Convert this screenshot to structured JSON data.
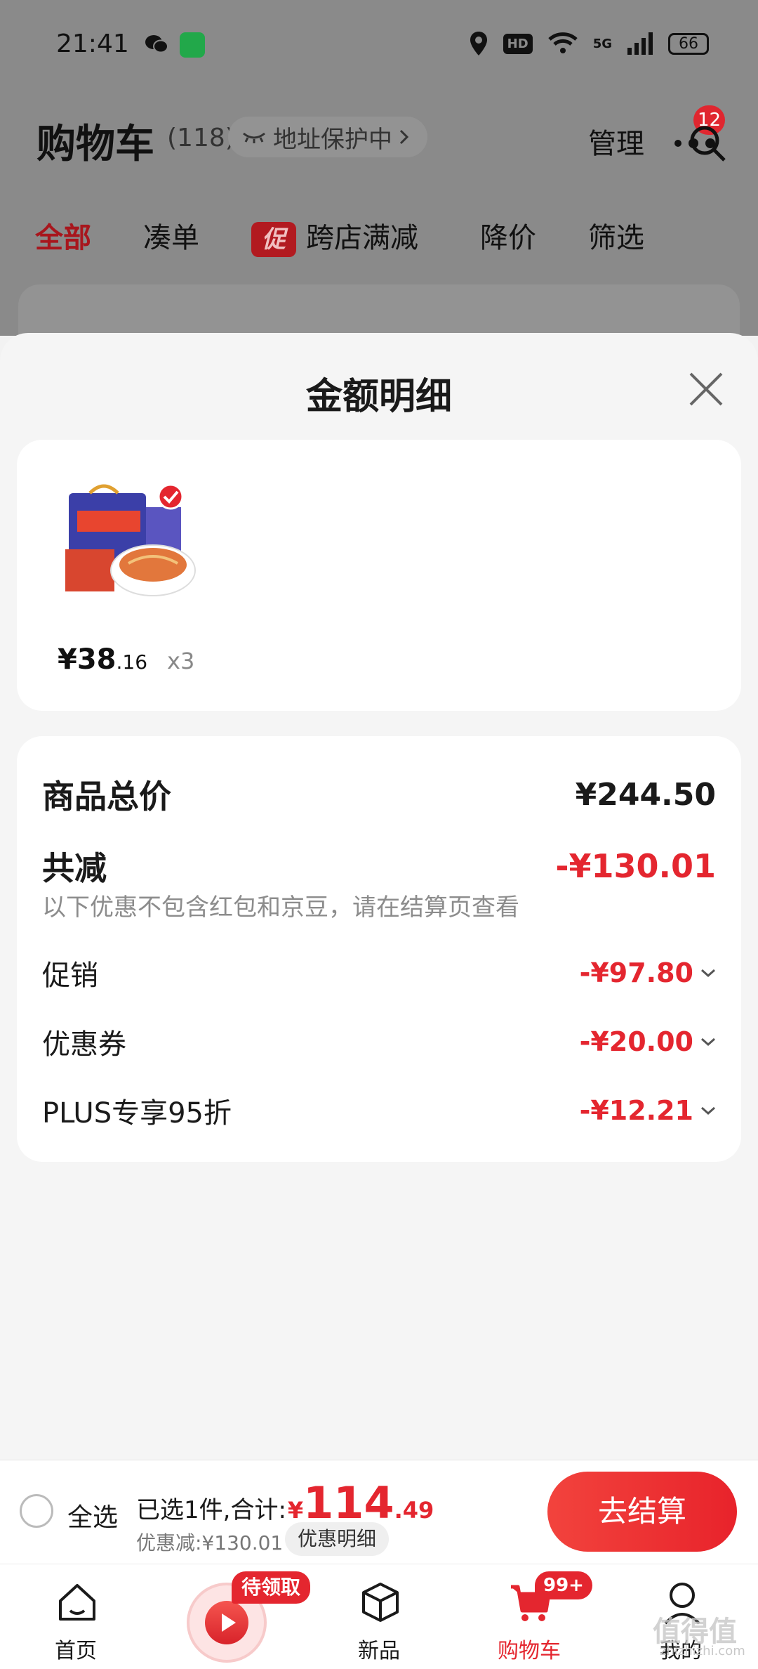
{
  "status_bar": {
    "time": "21:41",
    "network": "5G",
    "hd": "HD",
    "battery": "66"
  },
  "cart": {
    "title": "购物车",
    "count": "(118)",
    "address": "地址保护中",
    "manage": "管理",
    "more_badge": "12",
    "tabs": [
      {
        "label": "全部"
      },
      {
        "label": "凑单"
      },
      {
        "label": "跨店满减",
        "badge": "促"
      },
      {
        "label": "降价"
      },
      {
        "label": "筛选"
      }
    ]
  },
  "sheet": {
    "title": "金额明细",
    "product": {
      "price_int": "¥38",
      "price_dec": ".16",
      "quantity": "x3"
    },
    "summary": {
      "total_label": "商品总价",
      "total_value": "¥244.50",
      "reduce_label": "共减",
      "reduce_value": "-¥130.01",
      "note": "以下优惠不包含红包和京豆，请在结算页查看",
      "items": [
        {
          "label": "促销",
          "value": "-¥97.80"
        },
        {
          "label": "优惠券",
          "value": "-¥20.00"
        },
        {
          "label": "PLUS专享95折",
          "value": "-¥12.21"
        }
      ]
    }
  },
  "checkout": {
    "select_all": "全选",
    "selected_text": "已选1件,合计:",
    "total_yen": "¥",
    "total_int": "114",
    "total_dec": ".49",
    "discount_text": "优惠减:¥130.01",
    "detail_button": "优惠明细",
    "checkout_button": "去结算"
  },
  "nav": {
    "items": [
      {
        "label": "首页"
      },
      {
        "label": ""
      },
      {
        "label": "新品"
      },
      {
        "label": "购物车"
      },
      {
        "label": "我的"
      }
    ],
    "promo_tag": "待领取",
    "cart_badge": "99+"
  },
  "watermark": {
    "text": "值得值",
    "sub": "zhizhizhi.com"
  },
  "colors": {
    "accent_red": "#e4262f",
    "dim_overlay": "#8a8a8a"
  }
}
